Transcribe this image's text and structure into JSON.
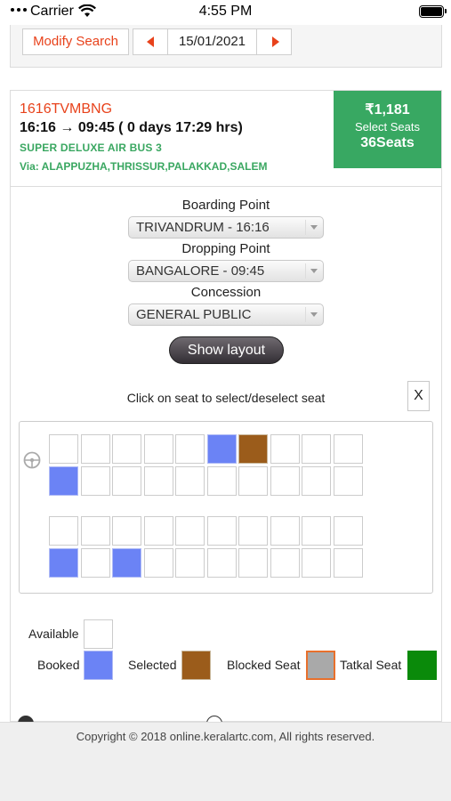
{
  "status_bar": {
    "carrier": "Carrier",
    "time": "4:55 PM"
  },
  "search": {
    "modify_label": "Modify Search",
    "date": "15/01/2021"
  },
  "trip": {
    "code": "1616TVMBNG",
    "time": "16:16 → 09:45 ( 0 days 17:29 hrs)",
    "bus_type": "SUPER DELUXE AIR BUS 3",
    "via": "Via: ALAPPUZHA,THRISSUR,PALAKKAD,SALEM",
    "price": "₹1,181",
    "select_seats": "Select Seats",
    "seats": "36Seats"
  },
  "boarding": {
    "label": "Boarding Point",
    "value": "TRIVANDRUM - 16:16"
  },
  "dropping": {
    "label": "Dropping Point",
    "value": "BANGALORE - 09:45"
  },
  "concession": {
    "label": "Concession",
    "value": "GENERAL PUBLIC"
  },
  "show_layout": "Show layout",
  "seat_hint": "Click on seat to select/deselect seat",
  "close_label": "X",
  "seat_rows": [
    [
      "available",
      "available",
      "available",
      "available",
      "available",
      "booked",
      "selected",
      "available",
      "available",
      "available"
    ],
    [
      "booked",
      "available",
      "available",
      "available",
      "available",
      "available",
      "available",
      "available",
      "available",
      "available"
    ],
    [
      "available",
      "available",
      "available",
      "available",
      "available",
      "available",
      "available",
      "available",
      "available",
      "available"
    ],
    [
      "booked",
      "available",
      "booked",
      "available",
      "available",
      "available",
      "available",
      "available",
      "available",
      "available"
    ]
  ],
  "legend": {
    "available": "Available",
    "booked": "Booked",
    "selected": "Selected",
    "blocked": "Blocked Seat",
    "tatkal": "Tatkal Seat"
  },
  "colors": {
    "accent": "#e8421b",
    "green": "#38a862",
    "booked": "#6b83f5",
    "selected": "#9b5c1b",
    "blocked": "#a9a9a9",
    "tatkal": "#0a8a0a"
  },
  "footer": {
    "copyright": "Copyright © 2018 online.keralartc.com, All rights reserved."
  }
}
